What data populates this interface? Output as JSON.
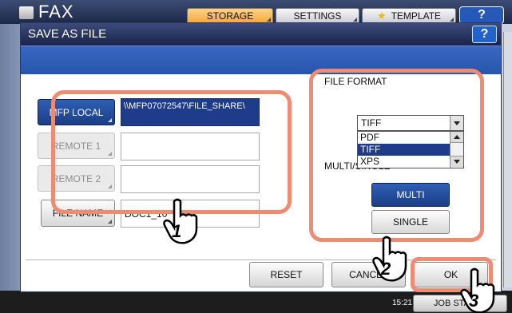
{
  "app": {
    "title": "FAX",
    "tabs": {
      "storage": "STORAGE",
      "settings": "SETTINGS",
      "template": "TEMPLATE"
    },
    "help": "?",
    "time": "15:21",
    "job_button": "JOB STATUS"
  },
  "dialog": {
    "title": "SAVE AS FILE",
    "help": "?",
    "destinations": [
      {
        "label": "MFP LOCAL",
        "path": "\\\\MFP07072547\\FILE_SHARE\\"
      },
      {
        "label": "REMOTE 1",
        "path": ""
      },
      {
        "label": "REMOTE 2",
        "path": ""
      }
    ],
    "file_name": {
      "label": "FILE NAME",
      "value": "DOC1_10"
    },
    "file_format": {
      "label": "FILE FORMAT",
      "selected": "TIFF",
      "options": [
        "PDF",
        "TIFF",
        "XPS"
      ]
    },
    "multi_single": {
      "label": "MULTI/SINGLE",
      "multi": "MULTI",
      "single": "SINGLE"
    },
    "buttons": {
      "reset": "RESET",
      "cancel": "CANCEL",
      "ok": "OK"
    }
  },
  "annotations": {
    "step1": "1",
    "step2": "2",
    "step3": "3",
    "highlight_color": "#ee8b73"
  },
  "colors": {
    "selected_blue": "#1f3c8b",
    "title_bar": "#1a244a",
    "band_blue": "#2756ae"
  }
}
